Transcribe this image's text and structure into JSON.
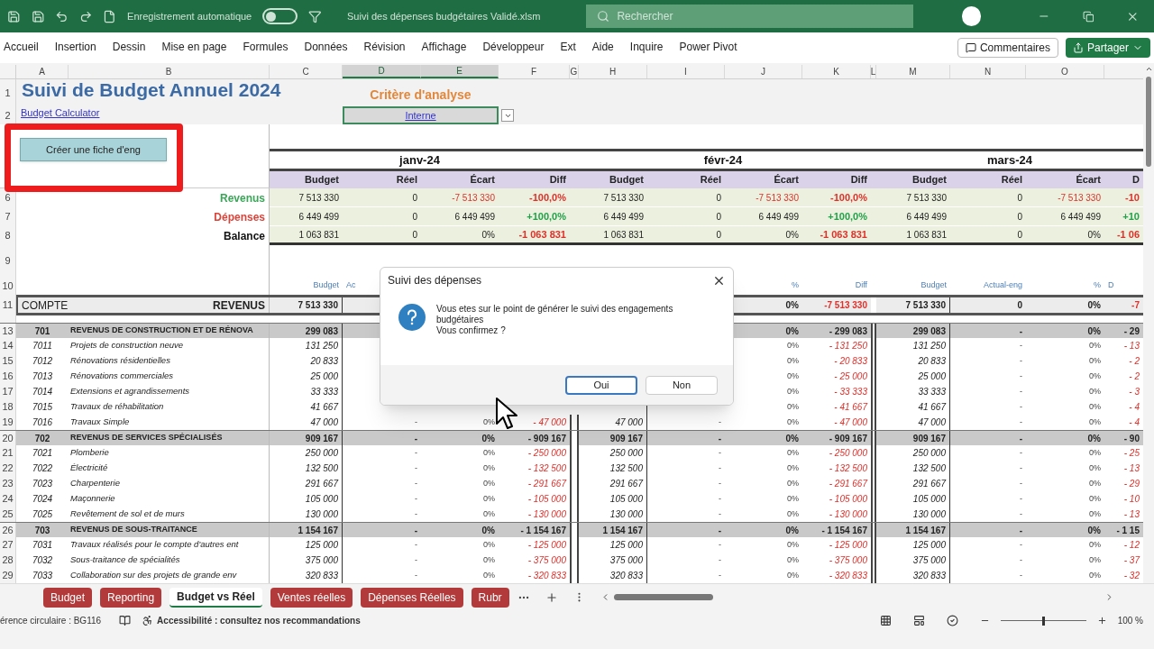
{
  "titlebar": {
    "autosave": {
      "label": "Enregistrement automatique",
      "on": false
    },
    "filename": "Suivi des dépenses budgétaires Validé.xlsm",
    "search": {
      "placeholder": "Rechercher"
    }
  },
  "ribbon": {
    "tabs": [
      {
        "label": "Accueil",
        "selected": false
      },
      {
        "label": "Insertion",
        "selected": false
      },
      {
        "label": "Dessin",
        "selected": false
      },
      {
        "label": "Mise en page",
        "selected": false
      },
      {
        "label": "Formules",
        "selected": false
      },
      {
        "label": "Données",
        "selected": false
      },
      {
        "label": "Révision",
        "selected": false
      },
      {
        "label": "Affichage",
        "selected": false
      },
      {
        "label": "Développeur",
        "selected": false
      },
      {
        "label": "Ext",
        "selected": false
      },
      {
        "label": "Aide",
        "selected": false
      },
      {
        "label": "Inquire",
        "selected": false
      },
      {
        "label": "Power Pivot",
        "selected": false
      }
    ],
    "comments": "Commentaires",
    "share": "Partager"
  },
  "columns": [
    {
      "letter": "A",
      "selected": false
    },
    {
      "letter": "B",
      "selected": false
    },
    {
      "letter": "C",
      "selected": false
    },
    {
      "letter": "D",
      "selected": true
    },
    {
      "letter": "E",
      "selected": true
    },
    {
      "letter": "F",
      "selected": false
    },
    {
      "letter": "G",
      "selected": false
    },
    {
      "letter": "H",
      "selected": false
    },
    {
      "letter": "I",
      "selected": false
    },
    {
      "letter": "J",
      "selected": false
    },
    {
      "letter": "K",
      "selected": false
    },
    {
      "letter": "L",
      "selected": false
    },
    {
      "letter": "M",
      "selected": false
    },
    {
      "letter": "N",
      "selected": false
    },
    {
      "letter": "O",
      "selected": false
    }
  ],
  "top": {
    "rows": [
      "1",
      "2"
    ],
    "title": "Suivi de Budget Annuel 2024",
    "subtitle": "Budget Calculator",
    "criteria_label": "Critère d'analyse",
    "criteria_value": "Interne",
    "button": "Créer une fiche d'eng"
  },
  "months": [
    {
      "label": "janv-24",
      "headers": [
        "Budget",
        "Réel",
        "Écart",
        "Diff"
      ]
    },
    {
      "label": "févr-24",
      "headers": [
        "Budget",
        "Réel",
        "Écart",
        "Diff"
      ]
    },
    {
      "label": "mars-24",
      "headers": [
        "Budget",
        "Réel",
        "Écart",
        "D"
      ]
    }
  ],
  "summary": [
    {
      "row": "6",
      "label": "Revenus",
      "color": "#3aa657",
      "cells": [
        "7 513 330",
        "0",
        {
          "v": "-7 513 330",
          "color": "#e0302a"
        },
        {
          "v": "-100,0%",
          "color": "#e0302a"
        },
        "7 513 330",
        "0",
        {
          "v": "-7 513 330",
          "color": "#e0302a"
        },
        {
          "v": "-100,0%",
          "color": "#e0302a"
        },
        "7 513 330",
        "0",
        {
          "v": "-7 513 330",
          "color": "#e0302a"
        },
        {
          "v": "-10",
          "color": "#e0302a"
        }
      ]
    },
    {
      "row": "7",
      "label": "Dépenses",
      "color": "#d9453b",
      "cells": [
        "6 449 499",
        "0",
        "6 449 499",
        {
          "v": "+100,0%",
          "color": "#22a04a"
        },
        "6 449 499",
        "0",
        "6 449 499",
        {
          "v": "+100,0%",
          "color": "#22a04a"
        },
        "6 449 499",
        "0",
        "6 449 499",
        {
          "v": "+10",
          "color": "#22a04a"
        }
      ]
    },
    {
      "row": "8",
      "label": "Balance",
      "color": "#111111",
      "cells": [
        "1 063 831",
        "0",
        "0%",
        {
          "v": "-1 063 831",
          "color": "#e0302a"
        },
        "1 063 831",
        "0",
        "0%",
        {
          "v": "-1 063 831",
          "color": "#e0302a"
        },
        "1 063 831",
        "0",
        "0%",
        {
          "v": "-1 06",
          "color": "#e0302a"
        }
      ]
    }
  ],
  "spacer_row": "9",
  "detail_header": {
    "row": "10",
    "cells": [
      "Budget",
      "Ac",
      null,
      null,
      null,
      null,
      "%",
      "Diff",
      "Budget",
      "Actual-eng",
      "%",
      "D"
    ]
  },
  "total": {
    "row": "11",
    "code": "COMPTE",
    "label": "REVENUS",
    "cells": [
      "7 513 330",
      null,
      null,
      null,
      null,
      null,
      "0%",
      {
        "v": "-7 513 330",
        "color": "#e0302a"
      },
      "7 513 330",
      "0",
      "0%",
      {
        "v": "-7",
        "color": "#e0302a"
      }
    ]
  },
  "detail": [
    {
      "row": "13",
      "kind": "group",
      "code": "701",
      "label": "REVENUS DE CONSTRUCTION ET DE RÉNOVA",
      "cells": [
        "299 083",
        null,
        null,
        null,
        null,
        null,
        "0%",
        "- 299 083",
        "299 083",
        "-",
        "0%",
        "- 29"
      ]
    },
    {
      "row": "14",
      "kind": "item",
      "code": "7011",
      "label": "Projets de construction neuve",
      "cells": [
        "131 250",
        null,
        null,
        null,
        null,
        null,
        "0%",
        "- 131 250",
        "131 250",
        "-",
        "0%",
        "- 13"
      ]
    },
    {
      "row": "15",
      "kind": "item",
      "code": "7012",
      "label": "Rénovations résidentielles",
      "cells": [
        "20 833",
        null,
        null,
        null,
        null,
        null,
        "0%",
        "- 20 833",
        "20 833",
        "-",
        "0%",
        "- 2"
      ]
    },
    {
      "row": "16",
      "kind": "item",
      "code": "7013",
      "label": "Rénovations commerciales",
      "cells": [
        "25 000",
        null,
        null,
        null,
        null,
        null,
        "0%",
        "- 25 000",
        "25 000",
        "-",
        "0%",
        "- 2"
      ]
    },
    {
      "row": "17",
      "kind": "item",
      "code": "7014",
      "label": "Extensions et agrandissements",
      "cells": [
        "33 333",
        null,
        null,
        null,
        null,
        null,
        "0%",
        "- 33 333",
        "33 333",
        "-",
        "0%",
        "- 3"
      ]
    },
    {
      "row": "18",
      "kind": "item",
      "code": "7015",
      "label": "Travaux de réhabilitation",
      "cells": [
        "41 667",
        null,
        null,
        null,
        null,
        null,
        "0%",
        "- 41 667",
        "41 667",
        "-",
        "0%",
        "- 4"
      ]
    },
    {
      "row": "19",
      "kind": "item",
      "code": "7016",
      "label": "Travaux Simple",
      "cells": [
        "47 000",
        "-",
        "0%",
        "- 47 000",
        "47 000",
        "-",
        "0%",
        "- 47 000",
        "47 000",
        "-",
        "0%",
        "- 4"
      ]
    },
    {
      "row": "20",
      "kind": "group",
      "code": "702",
      "label": "REVENUS DE SERVICES SPÉCIALISÉS",
      "cells": [
        "909 167",
        "-",
        "0%",
        "- 909 167",
        "909 167",
        "-",
        "0%",
        "- 909 167",
        "909 167",
        "-",
        "0%",
        "- 90"
      ]
    },
    {
      "row": "21",
      "kind": "item",
      "code": "7021",
      "label": "Plomberie",
      "cells": [
        "250 000",
        "-",
        "0%",
        "- 250 000",
        "250 000",
        "-",
        "0%",
        "- 250 000",
        "250 000",
        "-",
        "0%",
        "- 25"
      ]
    },
    {
      "row": "22",
      "kind": "item",
      "code": "7022",
      "label": "Électricité",
      "cells": [
        "132 500",
        "-",
        "0%",
        "- 132 500",
        "132 500",
        "-",
        "0%",
        "- 132 500",
        "132 500",
        "-",
        "0%",
        "- 13"
      ]
    },
    {
      "row": "23",
      "kind": "item",
      "code": "7023",
      "label": "Charpenterie",
      "cells": [
        "291 667",
        "-",
        "0%",
        "- 291 667",
        "291 667",
        "-",
        "0%",
        "- 291 667",
        "291 667",
        "-",
        "0%",
        "- 29"
      ]
    },
    {
      "row": "24",
      "kind": "item",
      "code": "7024",
      "label": "Maçonnerie",
      "cells": [
        "105 000",
        "-",
        "0%",
        "- 105 000",
        "105 000",
        "-",
        "0%",
        "- 105 000",
        "105 000",
        "-",
        "0%",
        "- 10"
      ]
    },
    {
      "row": "25",
      "kind": "item",
      "code": "7025",
      "label": "Revêtement de sol et de murs",
      "cells": [
        "130 000",
        "-",
        "0%",
        "- 130 000",
        "130 000",
        "-",
        "0%",
        "- 130 000",
        "130 000",
        "-",
        "0%",
        "- 13"
      ]
    },
    {
      "row": "26",
      "kind": "group",
      "code": "703",
      "label": "REVENUS DE SOUS-TRAITANCE",
      "cells": [
        "1 154 167",
        "-",
        "0%",
        "- 1 154 167",
        "1 154 167",
        "-",
        "0%",
        "- 1 154 167",
        "1 154 167",
        "-",
        "0%",
        "- 1 15"
      ]
    },
    {
      "row": "27",
      "kind": "item",
      "code": "7031",
      "label": "Travaux réalisés pour le compte d'autres ent",
      "cells": [
        "125 000",
        "-",
        "0%",
        "- 125 000",
        "125 000",
        "-",
        "0%",
        "- 125 000",
        "125 000",
        "-",
        "0%",
        "- 12"
      ]
    },
    {
      "row": "28",
      "kind": "item",
      "code": "7032",
      "label": "Sous-traitance de spécialités",
      "cells": [
        "375 000",
        "-",
        "0%",
        "- 375 000",
        "375 000",
        "-",
        "0%",
        "- 375 000",
        "375 000",
        "-",
        "0%",
        "- 37"
      ]
    },
    {
      "row": "29",
      "kind": "item",
      "code": "7033",
      "label": "Collaboration sur des projets de grande env",
      "cells": [
        "320 833",
        "-",
        "0%",
        "- 320 833",
        "320 833",
        "-",
        "0%",
        "- 320 833",
        "320 833",
        "-",
        "0%",
        "- 32"
      ]
    }
  ],
  "dialog": {
    "title": "Suivi des dépenses",
    "message": "Vous etes sur le point de générer le suivi des engagements budgétaires",
    "question": "Vous confirmez ?",
    "buttons": [
      {
        "label": "Oui",
        "selected": true
      },
      {
        "label": "Non",
        "selected": false
      }
    ]
  },
  "sheet_tabs": [
    {
      "label": "Budget",
      "selected": false
    },
    {
      "label": "Reporting",
      "selected": false
    },
    {
      "label": "Budget vs Réel",
      "selected": true
    },
    {
      "label": "Ventes réelles",
      "selected": false
    },
    {
      "label": "Dépenses Réelles",
      "selected": false
    },
    {
      "label": "Rubr",
      "selected": false
    }
  ],
  "status": {
    "circular": "érence circulaire : BG116",
    "accessibility": "Accessibilité : consultez nos recommandations",
    "zoom": {
      "level": 0.5,
      "reading": "100 %"
    }
  }
}
